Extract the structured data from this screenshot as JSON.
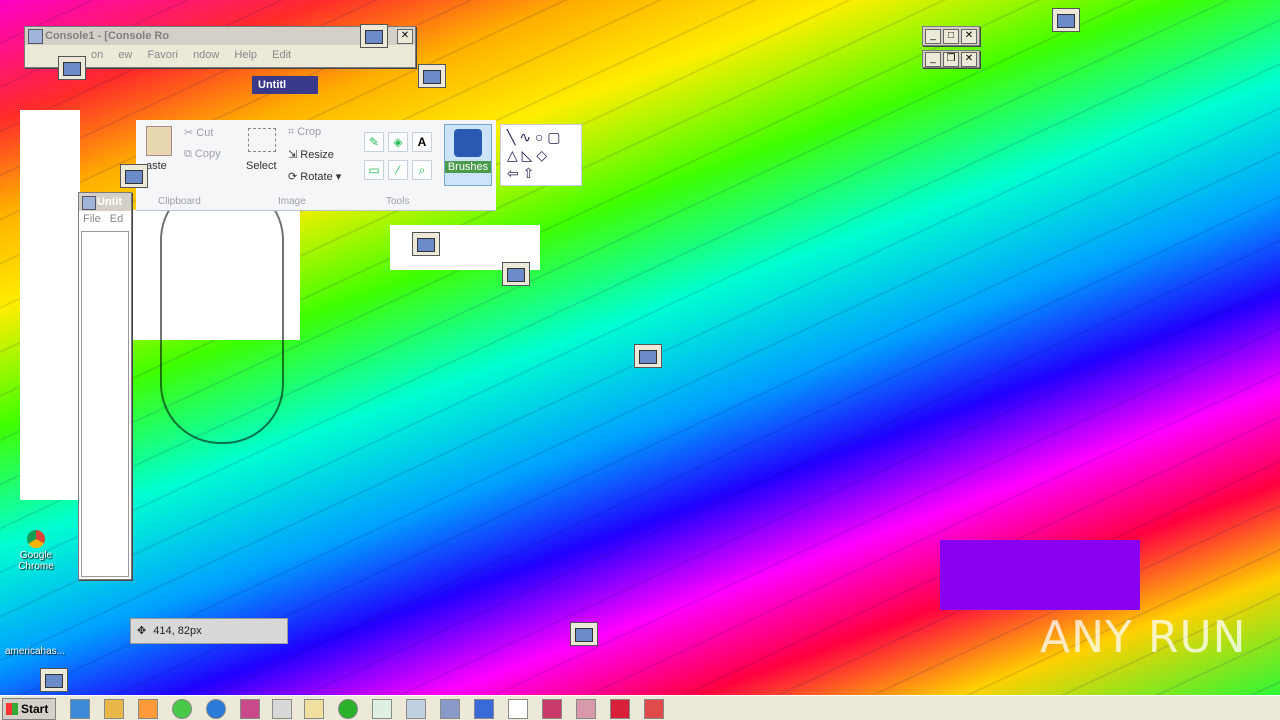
{
  "console_window": {
    "title": "Console1 - [Console Ro",
    "menu": [
      "on",
      "ew",
      "Favori",
      "ndow",
      "Help",
      "Edit"
    ]
  },
  "paint_window": {
    "title": "Untitl",
    "clipboard": {
      "paste": "aste",
      "cut": "Cut",
      "copy": "Copy",
      "group": "Clipboard"
    },
    "image": {
      "select": "Select",
      "crop": "Crop",
      "resize": "Resize",
      "rotate": "Rotate",
      "group": "Image"
    },
    "tools": {
      "group": "Tools",
      "text_tool": "A"
    },
    "brushes": "Brushes"
  },
  "notepad_window": {
    "title": "Untit",
    "menu": [
      "File",
      "Ed"
    ]
  },
  "status": {
    "coordinates": "414, 82px"
  },
  "desktop_icons": [
    {
      "label": "Google Chrome"
    },
    {
      "label": "americahas..."
    }
  ],
  "taskbar": {
    "start_label": "Start"
  },
  "watermark": "ANY RUN",
  "colors": {
    "accent": "#316ac5",
    "taskbar": "#ece9d8"
  }
}
